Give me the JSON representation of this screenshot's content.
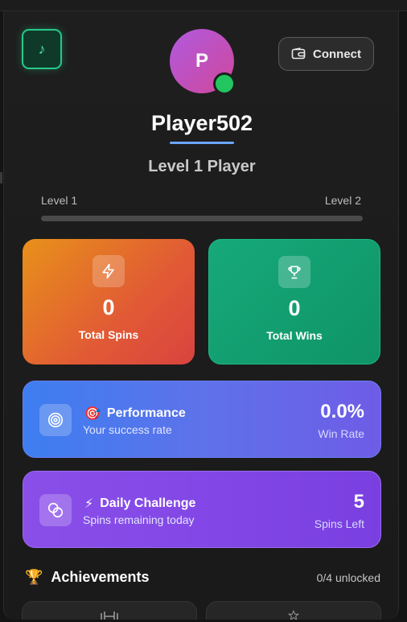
{
  "header": {
    "music_icon": "music-note-icon",
    "connect_label": "Connect",
    "connect_icon": "wallet-icon"
  },
  "profile": {
    "avatar_initial": "P",
    "name": "Player502",
    "level_title": "Level 1 Player",
    "level_from": "Level 1",
    "level_to": "Level 2",
    "level_progress_percent": 0
  },
  "stats": [
    {
      "value": "0",
      "label": "Total Spins",
      "icon": "lightning-icon"
    },
    {
      "value": "0",
      "label": "Total Wins",
      "icon": "trophy-icon"
    }
  ],
  "performance": {
    "emoji": "🎯",
    "title": "Performance",
    "subtitle": "Your success rate",
    "value": "0.0%",
    "unit": "Win Rate",
    "icon": "target-icon"
  },
  "daily_challenge": {
    "emoji": "⚡",
    "title": "Daily Challenge",
    "subtitle": "Spins remaining today",
    "value": "5",
    "unit": "Spins Left",
    "icon": "coins-icon"
  },
  "achievements": {
    "emoji": "🏆",
    "title": "Achievements",
    "count": "0/4 unlocked"
  },
  "colors": {
    "accent_green": "#25c98a",
    "spins_gradient": "#e8911a",
    "wins_gradient": "#16a97a",
    "performance_gradient": "#3d7ef0",
    "challenge_gradient": "#8a4fe8",
    "online_status": "#22c55e"
  }
}
